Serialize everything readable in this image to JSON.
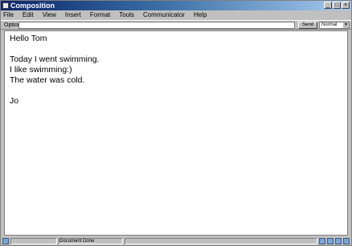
{
  "window": {
    "title": "Composition"
  },
  "menubar": [
    "File",
    "Edit",
    "View",
    "Insert",
    "Format",
    "Tools",
    "Communicator",
    "Help"
  ],
  "location": {
    "label": "Options",
    "value": "",
    "button_label": "Send",
    "select_value": "Normal"
  },
  "message": {
    "greeting": "Hello Tom",
    "line1": "Today I went swimming.",
    "line2": "I like swimming:)",
    "line3": "The water was cold.",
    "signature": "Jo"
  },
  "status": {
    "text": "Document Done"
  }
}
